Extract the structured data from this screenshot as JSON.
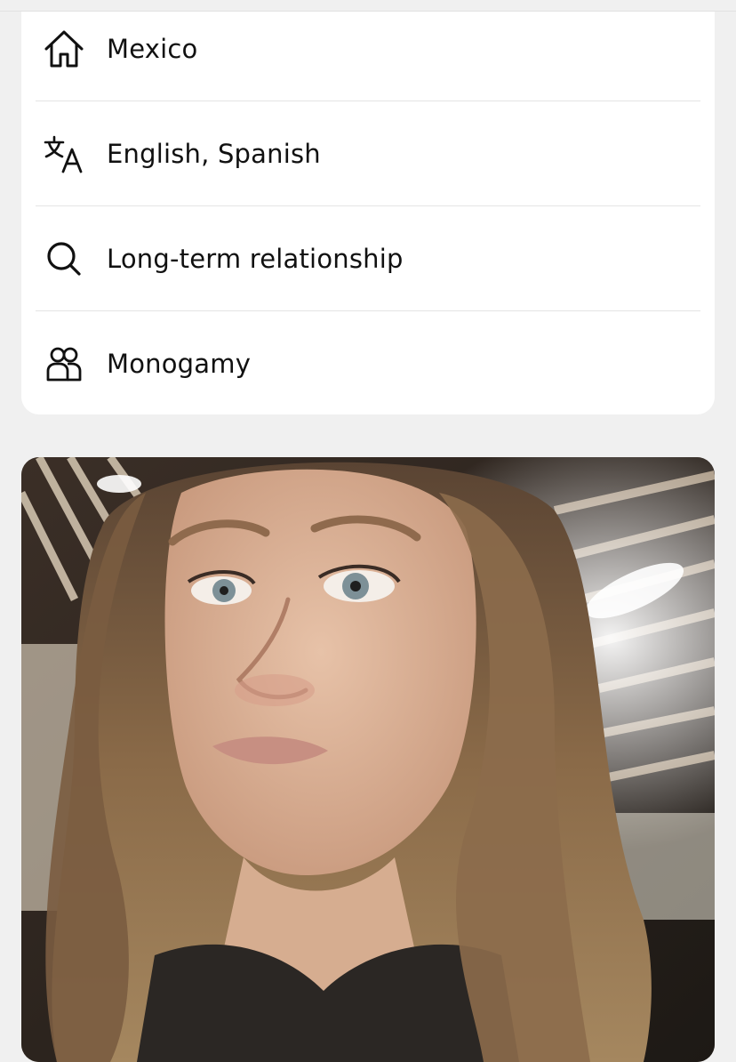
{
  "profile_details": {
    "items": [
      {
        "icon": "home-icon",
        "label": "Mexico"
      },
      {
        "icon": "translate-icon",
        "label": "English, Spanish"
      },
      {
        "icon": "search-icon",
        "label": "Long-term relationship"
      },
      {
        "icon": "people-icon",
        "label": "Monogamy"
      }
    ]
  },
  "photo": {
    "subject": "profile-photo"
  },
  "colors": {
    "page_background": "#f0f0f0",
    "card_background": "#ffffff",
    "text": "#111111",
    "divider": "#e4e4e4"
  }
}
